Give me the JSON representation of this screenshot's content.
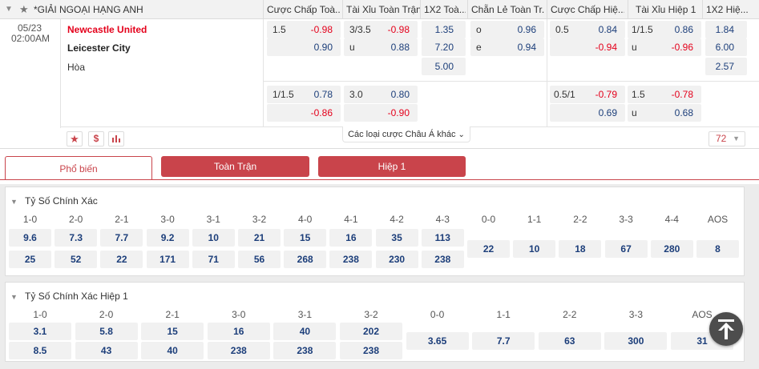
{
  "header": {
    "league": "*GIẢI NGOẠI HẠNG ANH",
    "columns": [
      "Cược Chấp Toà...",
      "Tài Xỉu Toàn Trận",
      "1X2 Toà...",
      "Chẵn Lẻ Toàn Tr...",
      "Cược Chấp Hiệ...",
      "Tài Xỉu Hiệp 1",
      "1X2 Hiệ..."
    ]
  },
  "match": {
    "date": "05/23",
    "time": "02:00AM",
    "home": "Newcastle United",
    "away": "Leicester City",
    "draw": "Hòa",
    "main": {
      "hdp_line": "1.5",
      "hdp_home": "-0.98",
      "hdp_away": "0.90",
      "ou_line": "3/3.5",
      "ou_over": "-0.98",
      "ou_under_label": "u",
      "ou_under": "0.88",
      "x12_home": "1.35",
      "x12_away": "7.20",
      "x12_draw": "5.00",
      "oe_o_label": "o",
      "oe_o": "0.96",
      "oe_e_label": "e",
      "oe_e": "0.94",
      "h1_hdp_line": "0.5",
      "h1_hdp_home": "0.84",
      "h1_hdp_away": "-0.94",
      "h1_ou_line": "1/1.5",
      "h1_ou_over": "0.86",
      "h1_ou_under_label": "u",
      "h1_ou_under": "-0.96",
      "h1_x12_home": "1.84",
      "h1_x12_away": "6.00",
      "h1_x12_draw": "2.57"
    },
    "alt": {
      "hdp_line": "1/1.5",
      "hdp_home": "0.78",
      "hdp_away": "-0.86",
      "ou_line": "3.0",
      "ou_over": "0.80",
      "ou_under": "-0.90",
      "h1_hdp_line": "0.5/1",
      "h1_hdp_home": "-0.79",
      "h1_hdp_away": "0.69",
      "h1_ou_line": "1.5",
      "h1_ou_over": "-0.78",
      "h1_ou_under_label": "u",
      "h1_ou_under": "0.68"
    },
    "more_bets": "Các loại cược Châu Á khác",
    "more_count": "72"
  },
  "tabs": [
    "Phổ biến",
    "Toàn Trận",
    "Hiệp 1"
  ],
  "correct_score": {
    "title": "Tỷ Số Chính Xác",
    "headers": [
      "1-0",
      "2-0",
      "2-1",
      "3-0",
      "3-1",
      "3-2",
      "4-0",
      "4-1",
      "4-2",
      "4-3",
      "0-0",
      "1-1",
      "2-2",
      "3-3",
      "4-4",
      "AOS"
    ],
    "row_home": [
      "9.6",
      "7.3",
      "7.7",
      "9.2",
      "10",
      "21",
      "15",
      "16",
      "35",
      "113"
    ],
    "row_away": [
      "25",
      "52",
      "22",
      "171",
      "71",
      "56",
      "268",
      "238",
      "230",
      "238"
    ],
    "draws": [
      "22",
      "10",
      "18",
      "67",
      "280",
      "8"
    ]
  },
  "correct_score_h1": {
    "title": "Tỷ Số Chính Xác Hiệp 1",
    "headers": [
      "1-0",
      "2-0",
      "2-1",
      "3-0",
      "3-1",
      "3-2",
      "0-0",
      "1-1",
      "2-2",
      "3-3",
      "AOS"
    ],
    "row_home": [
      "3.1",
      "5.8",
      "15",
      "16",
      "40",
      "202"
    ],
    "row_away": [
      "8.5",
      "43",
      "40",
      "238",
      "238",
      "238"
    ],
    "draws": [
      "3.65",
      "7.7",
      "63",
      "300",
      "31"
    ]
  },
  "colors": {
    "accent": "#c9444b",
    "odds_red": "#e4001b",
    "odds_blue": "#1c3e7a"
  }
}
